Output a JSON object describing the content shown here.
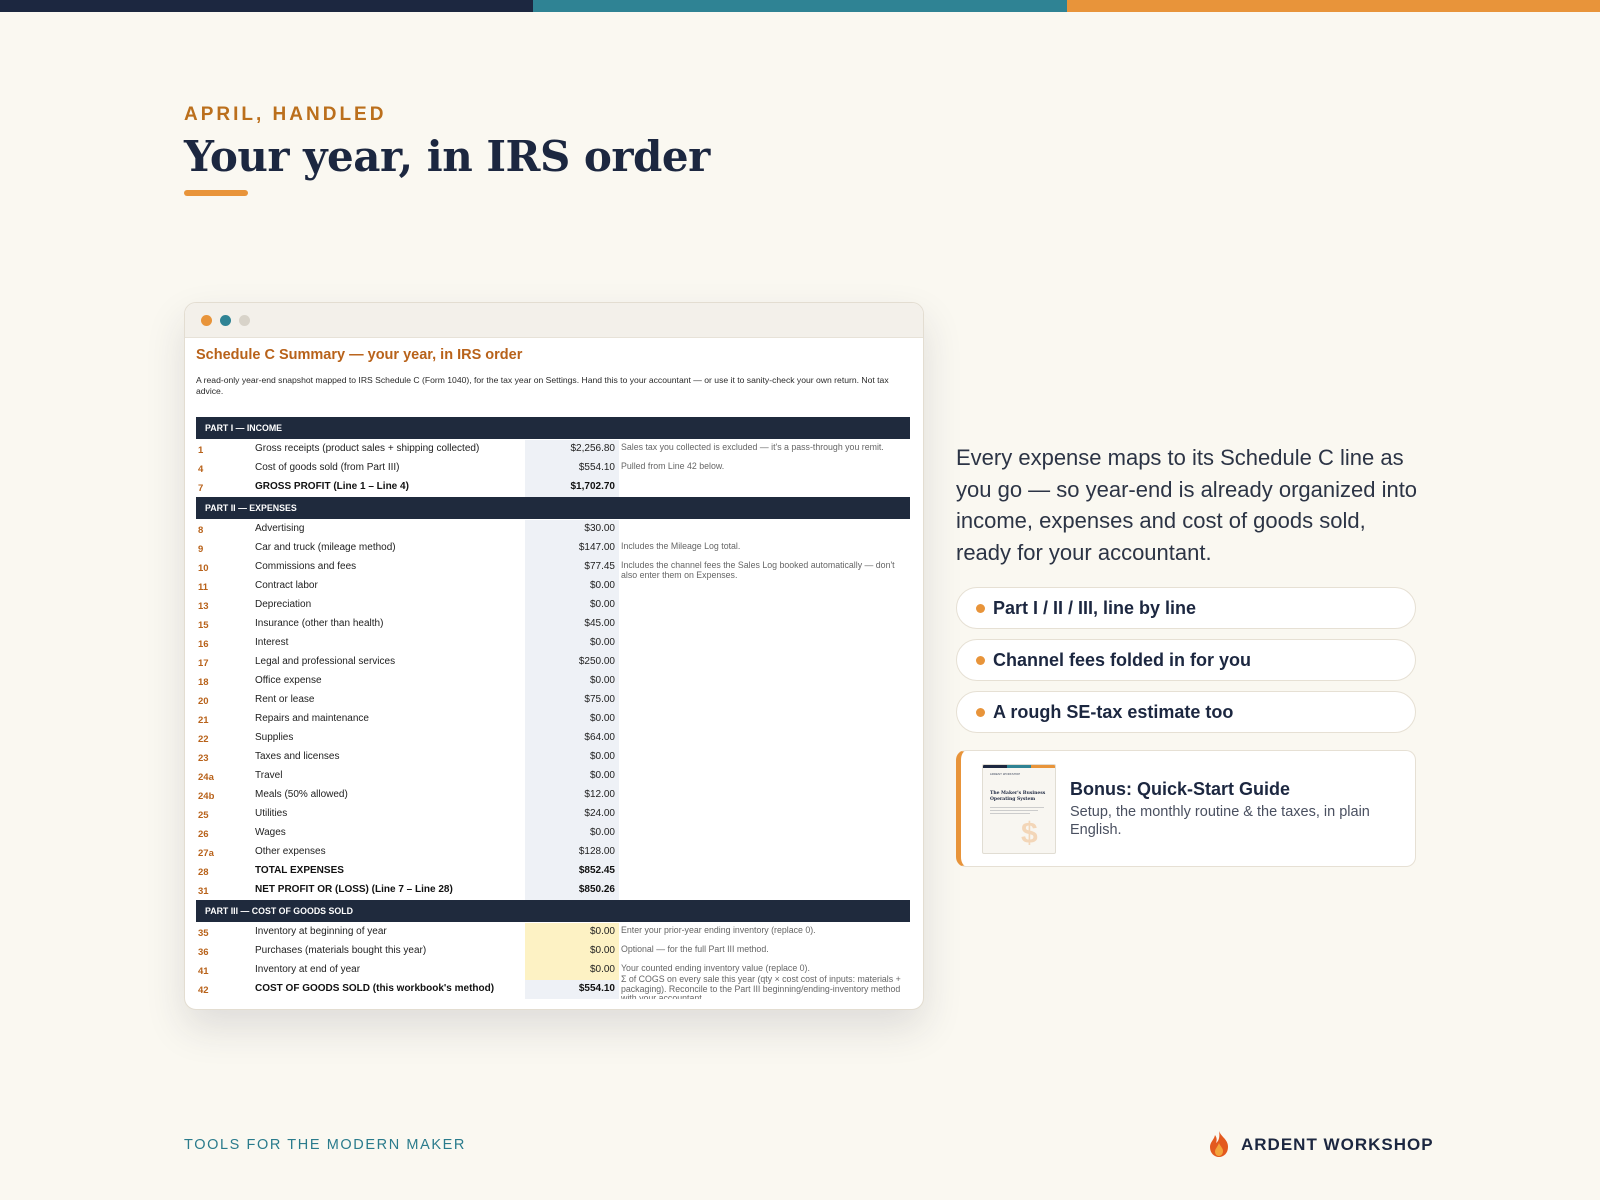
{
  "colors": {
    "navy": "#1c2740",
    "teal": "#2f8394",
    "orange": "#e8943a",
    "bg": "#faf8f1"
  },
  "header": {
    "eyebrow": "APRIL, HANDLED",
    "title": "Your year, in IRS order"
  },
  "spreadsheet": {
    "title": "Schedule C Summary — your year, in IRS order",
    "description": "A read-only year-end snapshot mapped to IRS Schedule C (Form 1040), for the tax year on Settings. Hand this to your accountant — or use it to sanity-check your own return. Not tax advice.",
    "sections": [
      {
        "heading": "PART I — INCOME",
        "rows": [
          {
            "line": "1",
            "label": "Gross receipts (product sales + shipping collected)",
            "amount": "$2,256.80",
            "note": "Sales tax you collected is excluded — it's a pass-through you remit."
          },
          {
            "line": "4",
            "label": "Cost of goods sold (from Part III)",
            "amount": "$554.10",
            "note": "Pulled from Line 42 below."
          },
          {
            "line": "7",
            "label": "GROSS PROFIT (Line 1 – Line 4)",
            "amount": "$1,702.70",
            "note": "",
            "bold": true
          }
        ]
      },
      {
        "heading": "PART II — EXPENSES",
        "rows": [
          {
            "line": "8",
            "label": "Advertising",
            "amount": "$30.00",
            "note": ""
          },
          {
            "line": "9",
            "label": "Car and truck (mileage method)",
            "amount": "$147.00",
            "note": "Includes the Mileage Log total."
          },
          {
            "line": "10",
            "label": "Commissions and fees",
            "amount": "$77.45",
            "note": "Includes the channel fees the Sales Log booked automatically — don't also enter them on Expenses."
          },
          {
            "line": "11",
            "label": "Contract labor",
            "amount": "$0.00",
            "note": ""
          },
          {
            "line": "13",
            "label": "Depreciation",
            "amount": "$0.00",
            "note": ""
          },
          {
            "line": "15",
            "label": "Insurance (other than health)",
            "amount": "$45.00",
            "note": ""
          },
          {
            "line": "16",
            "label": "Interest",
            "amount": "$0.00",
            "note": ""
          },
          {
            "line": "17",
            "label": "Legal and professional services",
            "amount": "$250.00",
            "note": ""
          },
          {
            "line": "18",
            "label": "Office expense",
            "amount": "$0.00",
            "note": ""
          },
          {
            "line": "20",
            "label": "Rent or lease",
            "amount": "$75.00",
            "note": ""
          },
          {
            "line": "21",
            "label": "Repairs and maintenance",
            "amount": "$0.00",
            "note": ""
          },
          {
            "line": "22",
            "label": "Supplies",
            "amount": "$64.00",
            "note": ""
          },
          {
            "line": "23",
            "label": "Taxes and licenses",
            "amount": "$0.00",
            "note": ""
          },
          {
            "line": "24a",
            "label": "Travel",
            "amount": "$0.00",
            "note": ""
          },
          {
            "line": "24b",
            "label": "Meals (50% allowed)",
            "amount": "$12.00",
            "note": ""
          },
          {
            "line": "25",
            "label": "Utilities",
            "amount": "$24.00",
            "note": ""
          },
          {
            "line": "26",
            "label": "Wages",
            "amount": "$0.00",
            "note": ""
          },
          {
            "line": "27a",
            "label": "Other expenses",
            "amount": "$128.00",
            "note": ""
          },
          {
            "line": "28",
            "label": "TOTAL EXPENSES",
            "amount": "$852.45",
            "note": "",
            "bold": true
          },
          {
            "line": "31",
            "label": "NET PROFIT OR (LOSS)  (Line 7 – Line 28)",
            "amount": "$850.26",
            "note": "",
            "bold": true
          }
        ]
      },
      {
        "heading": "PART III — COST OF GOODS SOLD",
        "rows": [
          {
            "line": "35",
            "label": "Inventory at beginning of year",
            "amount": "$0.00",
            "note": "Enter your prior-year ending inventory (replace 0).",
            "highlight": true
          },
          {
            "line": "36",
            "label": "Purchases (materials bought this year)",
            "amount": "$0.00",
            "note": "Optional — for the full Part III method.",
            "highlight": true
          },
          {
            "line": "41",
            "label": "Inventory at end of year",
            "amount": "$0.00",
            "note": "Your counted ending inventory value (replace 0).",
            "highlight": true
          },
          {
            "line": "42",
            "label": "COST OF GOODS SOLD (this workbook's method)",
            "amount": "$554.10",
            "note": "Σ of COGS on every sale this year (qty × cost cost of inputs: materials + packaging). Reconcile to the Part III beginning/ending-inventory method with your accountant.",
            "bold": true,
            "clip": true
          }
        ]
      }
    ]
  },
  "body_text": "Every expense maps to its Schedule C line as you go — so year-end is already organized into income, expenses and cost of goods sold, ready for your accountant.",
  "features": [
    "Part I / II / III, line by line",
    "Channel fees folded in for you",
    "A rough SE-tax estimate too"
  ],
  "bonus": {
    "title": "Bonus: Quick-Start Guide",
    "description": "Setup, the monthly routine & the taxes, in plain English.",
    "thumbnail_brand": "ARDENT WORKSHOP",
    "thumbnail_title": "The Maker's Business Operating System"
  },
  "footer": {
    "tagline": "TOOLS FOR THE MODERN MAKER",
    "brand": "ARDENT WORKSHOP",
    "brand_icon": "flame-icon"
  }
}
